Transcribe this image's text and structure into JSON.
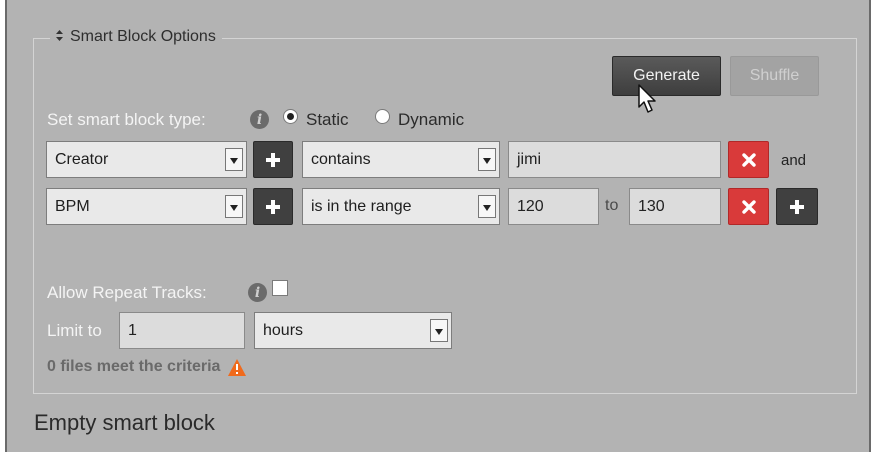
{
  "legend": {
    "title": "Smart Block Options"
  },
  "toolbar": {
    "generate_label": "Generate",
    "shuffle_label": "Shuffle"
  },
  "type_row": {
    "label": "Set smart block type:",
    "options": [
      "Static",
      "Dynamic"
    ],
    "selected": "Static"
  },
  "criteria": [
    {
      "field": "Creator",
      "operator": "contains",
      "value": "jimi",
      "connector": "and"
    },
    {
      "field": "BPM",
      "operator": "is in the range",
      "value": "120",
      "to_label": "to",
      "value2": "130"
    }
  ],
  "repeat": {
    "label": "Allow Repeat Tracks:",
    "checked": false
  },
  "limit": {
    "label": "Limit to",
    "value": "1",
    "unit": "hours"
  },
  "status": {
    "text": "0 files meet the criteria"
  },
  "footer": {
    "title": "Empty smart block"
  },
  "colors": {
    "panel": "#b3b3b3",
    "danger": "#d93a3a",
    "warning": "#f06a1c",
    "dark_button": "#404040"
  },
  "icons": [
    "sort-arrows-icon",
    "info-icon",
    "plus-icon",
    "close-icon",
    "warning-icon",
    "mouse-pointer-icon"
  ]
}
